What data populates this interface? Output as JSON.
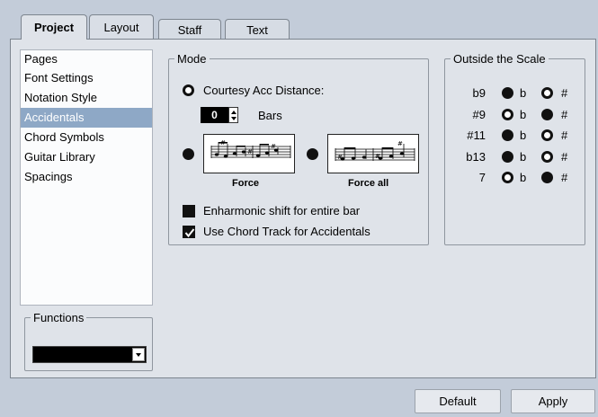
{
  "tabs": {
    "project": "Project",
    "layout": "Layout",
    "staff": "Staff",
    "text": "Text"
  },
  "pages": {
    "title": "Pages",
    "items": [
      "Font Settings",
      "Notation Style",
      "Accidentals",
      "Chord Symbols",
      "Guitar Library",
      "Spacings"
    ],
    "selected": "Accidentals"
  },
  "functions": {
    "title": "Functions",
    "value": ""
  },
  "mode": {
    "title": "Mode",
    "courtesy_label": "Courtesy Acc Distance:",
    "distance_value": "0",
    "bars_label": "Bars",
    "force_label": "Force",
    "force_all_label": "Force all",
    "enharmonic_label": "Enharmonic shift for entire bar",
    "enharmonic_checked": true,
    "chord_track_label": "Use Chord Track for Accidentals",
    "chord_track_checked": true
  },
  "outside_scale": {
    "title": "Outside the Scale",
    "flat_symbol": "b",
    "sharp_symbol": "#",
    "rows": [
      {
        "interval": "b9",
        "selected": "flat"
      },
      {
        "interval": "#9",
        "selected": "sharp"
      },
      {
        "interval": "#11",
        "selected": "flat"
      },
      {
        "interval": "b13",
        "selected": "flat"
      },
      {
        "interval": "7",
        "selected": "sharp"
      }
    ]
  },
  "buttons": {
    "default": "Default",
    "apply": "Apply"
  }
}
